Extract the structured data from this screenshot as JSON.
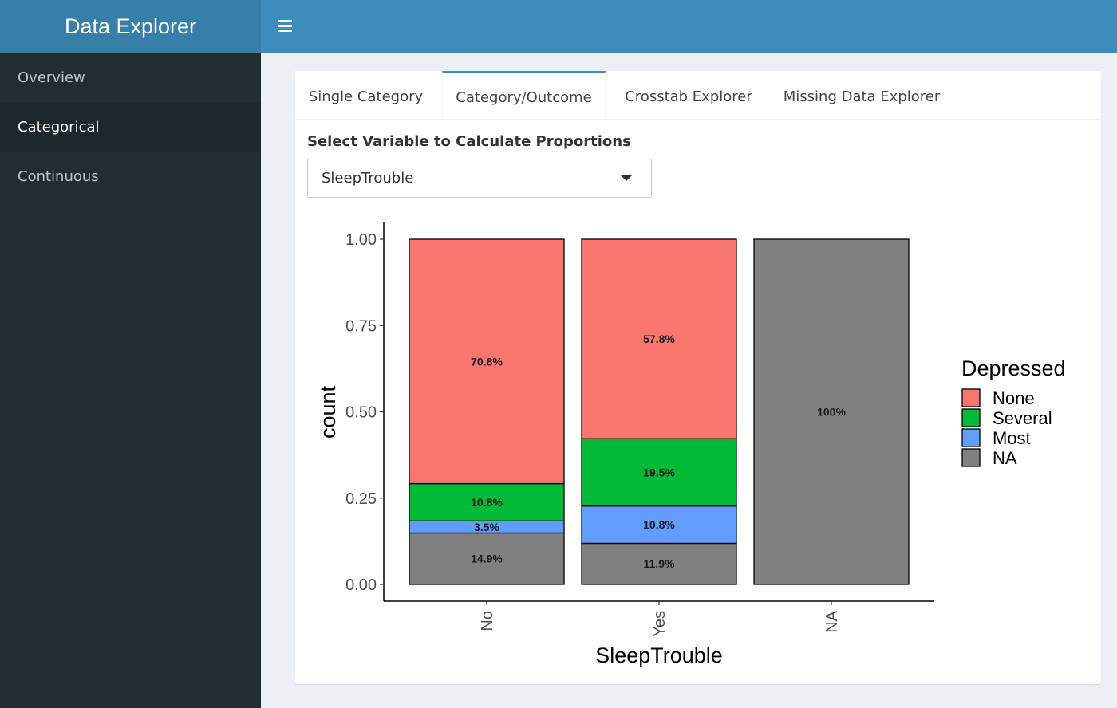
{
  "app": {
    "title": "Data Explorer"
  },
  "sidebar": {
    "items": [
      {
        "label": "Overview"
      },
      {
        "label": "Categorical"
      },
      {
        "label": "Continuous"
      }
    ]
  },
  "tabs": [
    {
      "label": "Single Category"
    },
    {
      "label": "Category/Outcome"
    },
    {
      "label": "Crosstab Explorer"
    },
    {
      "label": "Missing Data Explorer"
    }
  ],
  "control": {
    "label": "Select Variable to Calculate Proportions",
    "selected": "SleepTrouble"
  },
  "icons": {
    "menu": "hamburger-icon",
    "dropdown": "caret-down-icon"
  },
  "colors": {
    "header": "#3c8dbc",
    "logo_bg": "#367fa9",
    "sidebar": "#222d32"
  },
  "chart_data": {
    "type": "bar",
    "stacked": true,
    "xlabel": "SleepTrouble",
    "ylabel": "count",
    "ylim": [
      0,
      1
    ],
    "yticks": [
      "0.00",
      "0.25",
      "0.50",
      "0.75",
      "1.00"
    ],
    "categories": [
      "No",
      "Yes",
      "NA"
    ],
    "legend": {
      "title": "Depressed",
      "position": "right"
    },
    "grid": false,
    "series": [
      {
        "name": "NA",
        "color": "#808080",
        "values": [
          0.149,
          0.119,
          1.0
        ],
        "labels": [
          "14.9%",
          "11.9%",
          "100%"
        ]
      },
      {
        "name": "Most",
        "color": "#619cff",
        "values": [
          0.035,
          0.108,
          0
        ],
        "labels": [
          "3.5%",
          "10.8%",
          ""
        ]
      },
      {
        "name": "Several",
        "color": "#00ba38",
        "values": [
          0.108,
          0.195,
          0
        ],
        "labels": [
          "10.8%",
          "19.5%",
          ""
        ]
      },
      {
        "name": "None",
        "color": "#f8766d",
        "values": [
          0.708,
          0.578,
          0
        ],
        "labels": [
          "70.8%",
          "57.8%",
          ""
        ]
      }
    ],
    "legend_order": [
      "None",
      "Several",
      "Most",
      "NA"
    ]
  }
}
